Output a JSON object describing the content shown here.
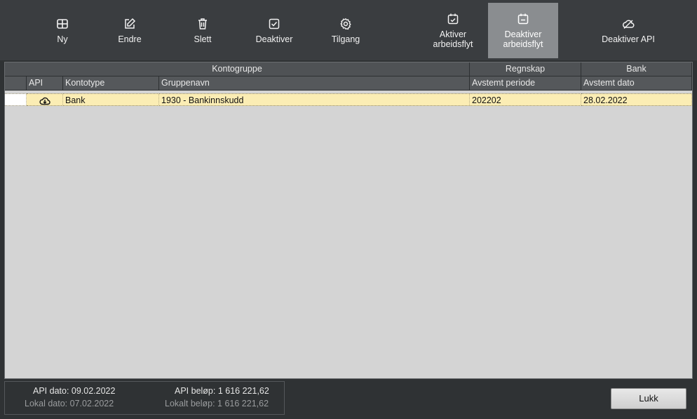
{
  "toolbar": {
    "buttons": [
      {
        "label": "Ny",
        "icon": "table-icon"
      },
      {
        "label": "Endre",
        "icon": "edit-icon"
      },
      {
        "label": "Slett",
        "icon": "trash-icon"
      },
      {
        "label": "Deaktiver",
        "icon": "checkbox-icon"
      },
      {
        "label": "Tilgang",
        "icon": "gear-icon"
      },
      {
        "label": "Aktiver\narbeidsflyt",
        "icon": "calendar-check-icon"
      },
      {
        "label": "Deaktiver\narbeidsflyt",
        "icon": "calendar-minus-icon",
        "active": true
      },
      {
        "label": "Deaktiver API",
        "icon": "cloud-off-icon"
      }
    ]
  },
  "grid": {
    "group_headers": [
      "Kontogruppe",
      "Regnskap",
      "Bank"
    ],
    "columns": [
      "API",
      "Kontotype",
      "Gruppenavn",
      "Avstemt periode",
      "Avstemt dato"
    ],
    "rows": [
      {
        "api_icon": "cloud-download-icon",
        "kontotype": "Bank",
        "gruppenavn": "1930 - Bankinnskudd",
        "avstemt_periode": "202202",
        "avstemt_dato": "28.02.2022"
      }
    ],
    "row_highlight": "#fbedb4"
  },
  "footer": {
    "api_dato": "API dato: 09.02.2022",
    "lokal_dato": "Lokal dato: 07.02.2022",
    "api_belop": "API beløp: 1 616 221,62",
    "lokalt_belop": "Lokalt beløp: 1 616 221,62",
    "close_label": "Lukk"
  },
  "colors": {
    "toolbar_bg": "#3a3d40",
    "active_button": "#8a8d90",
    "grid_bg": "#d4d4d4"
  }
}
